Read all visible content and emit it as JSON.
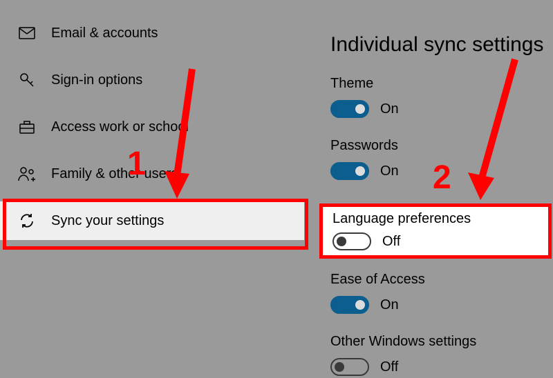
{
  "sidebar": {
    "items": [
      {
        "label": "Email & accounts"
      },
      {
        "label": "Sign-in options"
      },
      {
        "label": "Access work or school"
      },
      {
        "label": "Family & other users"
      },
      {
        "label": "Sync your settings"
      }
    ]
  },
  "panel": {
    "title": "Individual sync settings",
    "settings": [
      {
        "label": "Theme",
        "state": "On"
      },
      {
        "label": "Passwords",
        "state": "On"
      },
      {
        "label": "Language preferences",
        "state": "Off"
      },
      {
        "label": "Ease of Access",
        "state": "On"
      },
      {
        "label": "Other Windows settings",
        "state": "Off"
      }
    ]
  },
  "annotations": {
    "num1": "1",
    "num2": "2"
  }
}
